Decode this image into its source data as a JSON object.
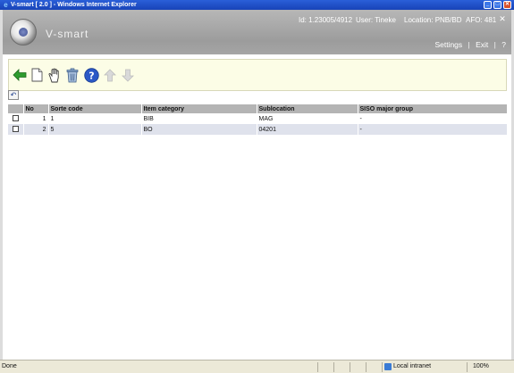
{
  "window": {
    "title": "V-smart [ 2.0 ] - Windows Internet Explorer",
    "controls": [
      "minimize",
      "maximize",
      "close"
    ]
  },
  "header": {
    "brand": "V-smart",
    "id_text": "Id: 1.23005/4912",
    "user_text": "User: Tineke",
    "location_text": "Location: PNB/BD",
    "afo_text": "AFO: 481",
    "links": {
      "settings": "Settings",
      "exit": "Exit",
      "help": "?"
    },
    "close_glyph": "✕"
  },
  "toolbar": {
    "buttons": [
      {
        "icon": "back-arrow-icon"
      },
      {
        "icon": "new-document-icon"
      },
      {
        "icon": "hand-select-icon"
      },
      {
        "icon": "trash-icon"
      },
      {
        "icon": "help-icon"
      },
      {
        "icon": "arrow-up-icon",
        "disabled": true
      },
      {
        "icon": "arrow-down-icon",
        "disabled": true
      }
    ]
  },
  "table": {
    "columns": [
      "No",
      "Sorte code",
      "Item category",
      "Sublocation",
      "SISO major group"
    ],
    "rows": [
      {
        "no": "1",
        "sorte_code": "1",
        "item_category": "BIB",
        "sublocation": "MAG",
        "siso": "-"
      },
      {
        "no": "2",
        "sorte_code": "5",
        "item_category": "BO",
        "sublocation": "04201",
        "siso": "-"
      }
    ]
  },
  "statusbar": {
    "status": "Done",
    "zone": "Local intranet",
    "zoom": "100%"
  },
  "colors": {
    "titlebar": "#1f4fd0",
    "header_bg": "#a6a6a6",
    "toolbar_bg": "#fcfde6",
    "table_header": "#b4b4b4",
    "row_alt": "#dfe2ec",
    "back_arrow": "#2e9b2e",
    "help_icon": "#2b58c6"
  }
}
